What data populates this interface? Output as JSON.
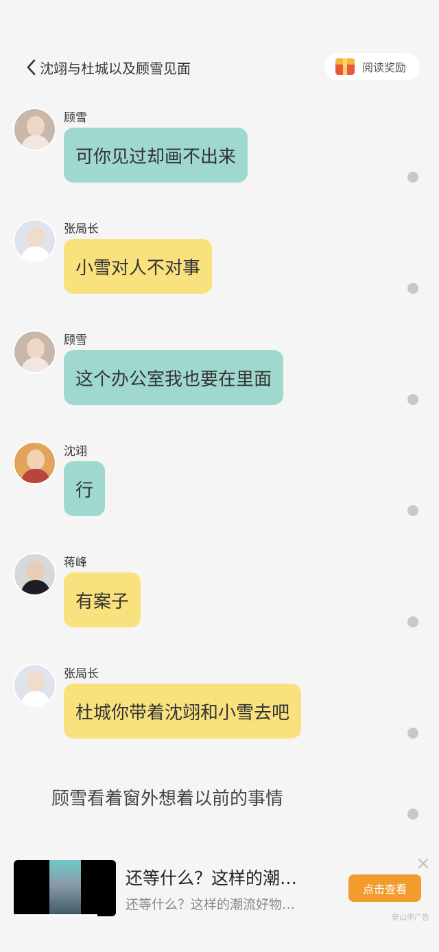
{
  "header": {
    "title": "沈翊与杜城以及顾雪见面",
    "reward_label": "阅读奖励"
  },
  "messages": [
    {
      "name": "顾雪",
      "text": "可你见过却画不出来",
      "bubble_color": "#9ed8cf"
    },
    {
      "name": "张局长",
      "text": "小雪对人不对事",
      "bubble_color": "#f9e17e"
    },
    {
      "name": "顾雪",
      "text": "这个办公室我也要在里面",
      "bubble_color": "#9ed8cf"
    },
    {
      "name": "沈翊",
      "text": "行",
      "bubble_color": "#9ed8cf"
    },
    {
      "name": "蒋峰",
      "text": "有案子",
      "bubble_color": "#f9e17e"
    },
    {
      "name": "张局长",
      "text": "杜城你带着沈翊和小雪去吧",
      "bubble_color": "#f9e17e"
    }
  ],
  "narration": "顾雪看着窗外想着以前的事情",
  "ad": {
    "title": "还等什么？这样的潮…",
    "subtitle": "还等什么？这样的潮流好物…",
    "button_label": "点击查看",
    "source": "穿山甲广告"
  },
  "colors": {
    "teal_bubble": "#9ed8cf",
    "yellow_bubble": "#f9e17e",
    "ad_button": "#f29b2f"
  }
}
